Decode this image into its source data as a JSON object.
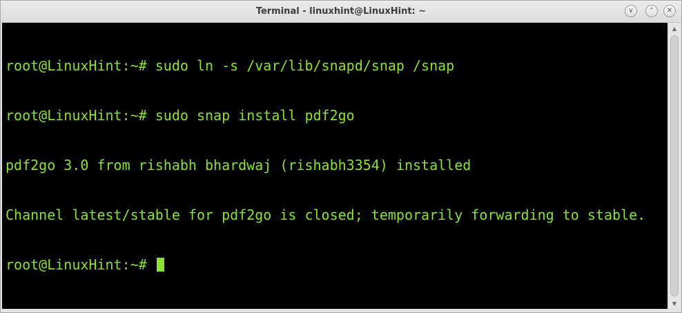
{
  "window": {
    "title": "Terminal - linuxhint@LinuxHint: ~",
    "minimize_glyph": "∨",
    "maximize_glyph": "⌃",
    "close_glyph": "✕"
  },
  "terminal": {
    "lines": [
      "root@LinuxHint:~# sudo ln -s /var/lib/snapd/snap /snap",
      "root@LinuxHint:~# sudo snap install pdf2go",
      "pdf2go 3.0 from rishabh bhardwaj (rishabh3354) installed",
      "Channel latest/stable for pdf2go is closed; temporarily forwarding to stable.",
      "root@LinuxHint:~# "
    ],
    "text_color": "#8ae234",
    "background_color": "#000000"
  },
  "scrollbar": {
    "up_glyph": "▲",
    "down_glyph": "▼"
  }
}
